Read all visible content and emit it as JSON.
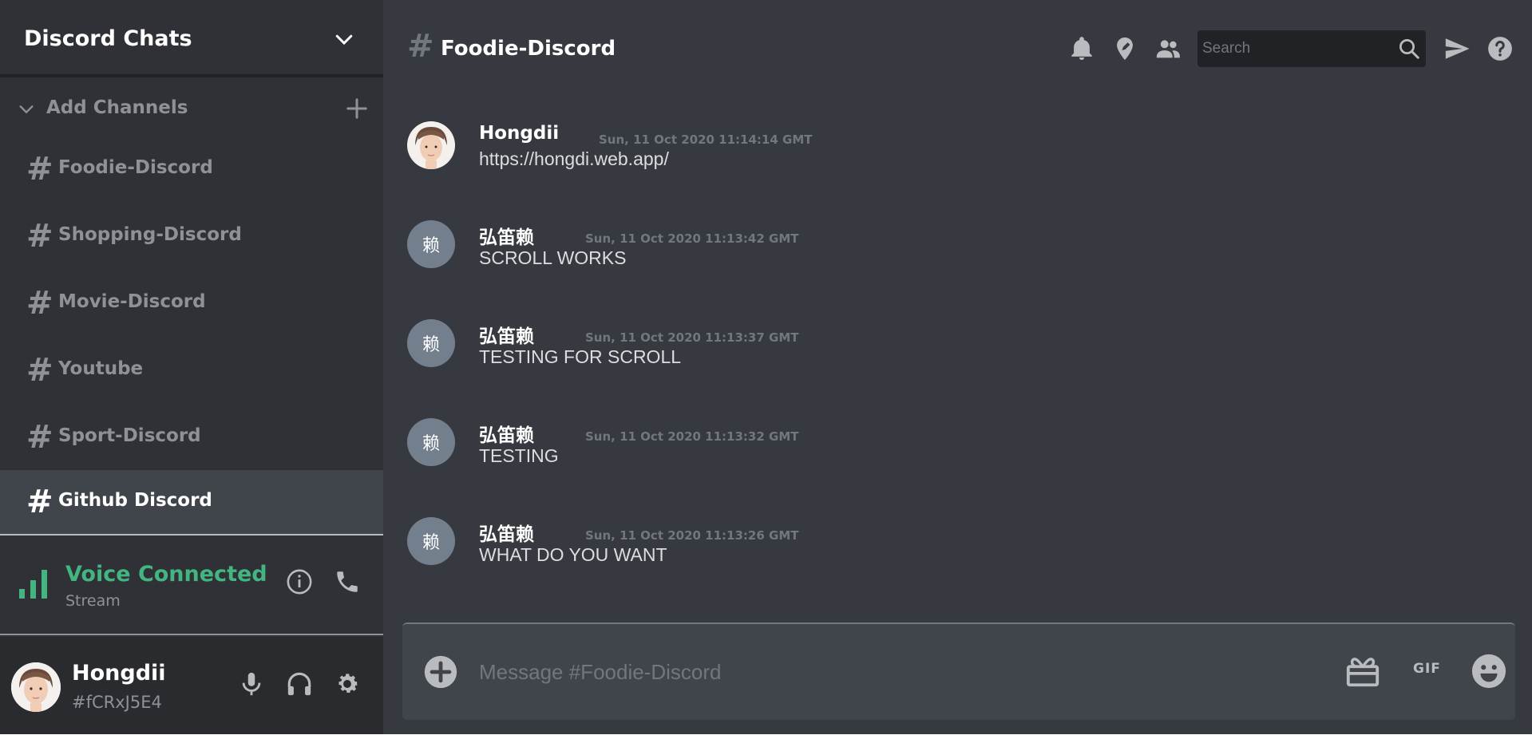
{
  "sidebar": {
    "title": "Discord Chats",
    "add_channels_label": "Add Channels",
    "channels": [
      {
        "label": "Foodie-Discord"
      },
      {
        "label": "Shopping-Discord"
      },
      {
        "label": "Movie-Discord"
      },
      {
        "label": "Youtube"
      },
      {
        "label": "Sport-Discord"
      },
      {
        "label": "Github Discord"
      }
    ],
    "hash_symbol": "#",
    "voice": {
      "title": "Voice Connected",
      "subtitle": "Stream",
      "color": "#43b581"
    },
    "user": {
      "name": "Hongdii",
      "tag": "#fCRxJ5E4"
    }
  },
  "header": {
    "hash_symbol": "#",
    "channel_title": "Foodie-Discord",
    "search_placeholder": "Search",
    "icons": [
      "bell-icon",
      "location-icon",
      "members-icon",
      "send-icon",
      "help-icon"
    ]
  },
  "messages": [
    {
      "author": "Hongdii",
      "time": "Sun, 11 Oct 2020 11:14:14 GMT",
      "text": "https://hongdi.web.app/",
      "avatar": "photo"
    },
    {
      "author": "弘笛赖",
      "time": "Sun, 11 Oct 2020 11:13:42 GMT",
      "text": "SCROLL WORKS",
      "avatar_text": "赖"
    },
    {
      "author": "弘笛赖",
      "time": "Sun, 11 Oct 2020 11:13:37 GMT",
      "text": "TESTING FOR SCROLL",
      "avatar_text": "赖"
    },
    {
      "author": "弘笛赖",
      "time": "Sun, 11 Oct 2020 11:13:32 GMT",
      "text": "TESTING",
      "avatar_text": "赖"
    },
    {
      "author": "弘笛赖",
      "time": "Sun, 11 Oct 2020 11:13:26 GMT",
      "text": "WHAT DO YOU WANT",
      "avatar_text": "赖"
    }
  ],
  "composer": {
    "placeholder": "Message #Foodie-Discord",
    "gif_label": "GIF"
  },
  "colors": {
    "sidebar_bg": "#2f3136",
    "main_bg": "#36393f",
    "accent_green": "#43b581"
  }
}
